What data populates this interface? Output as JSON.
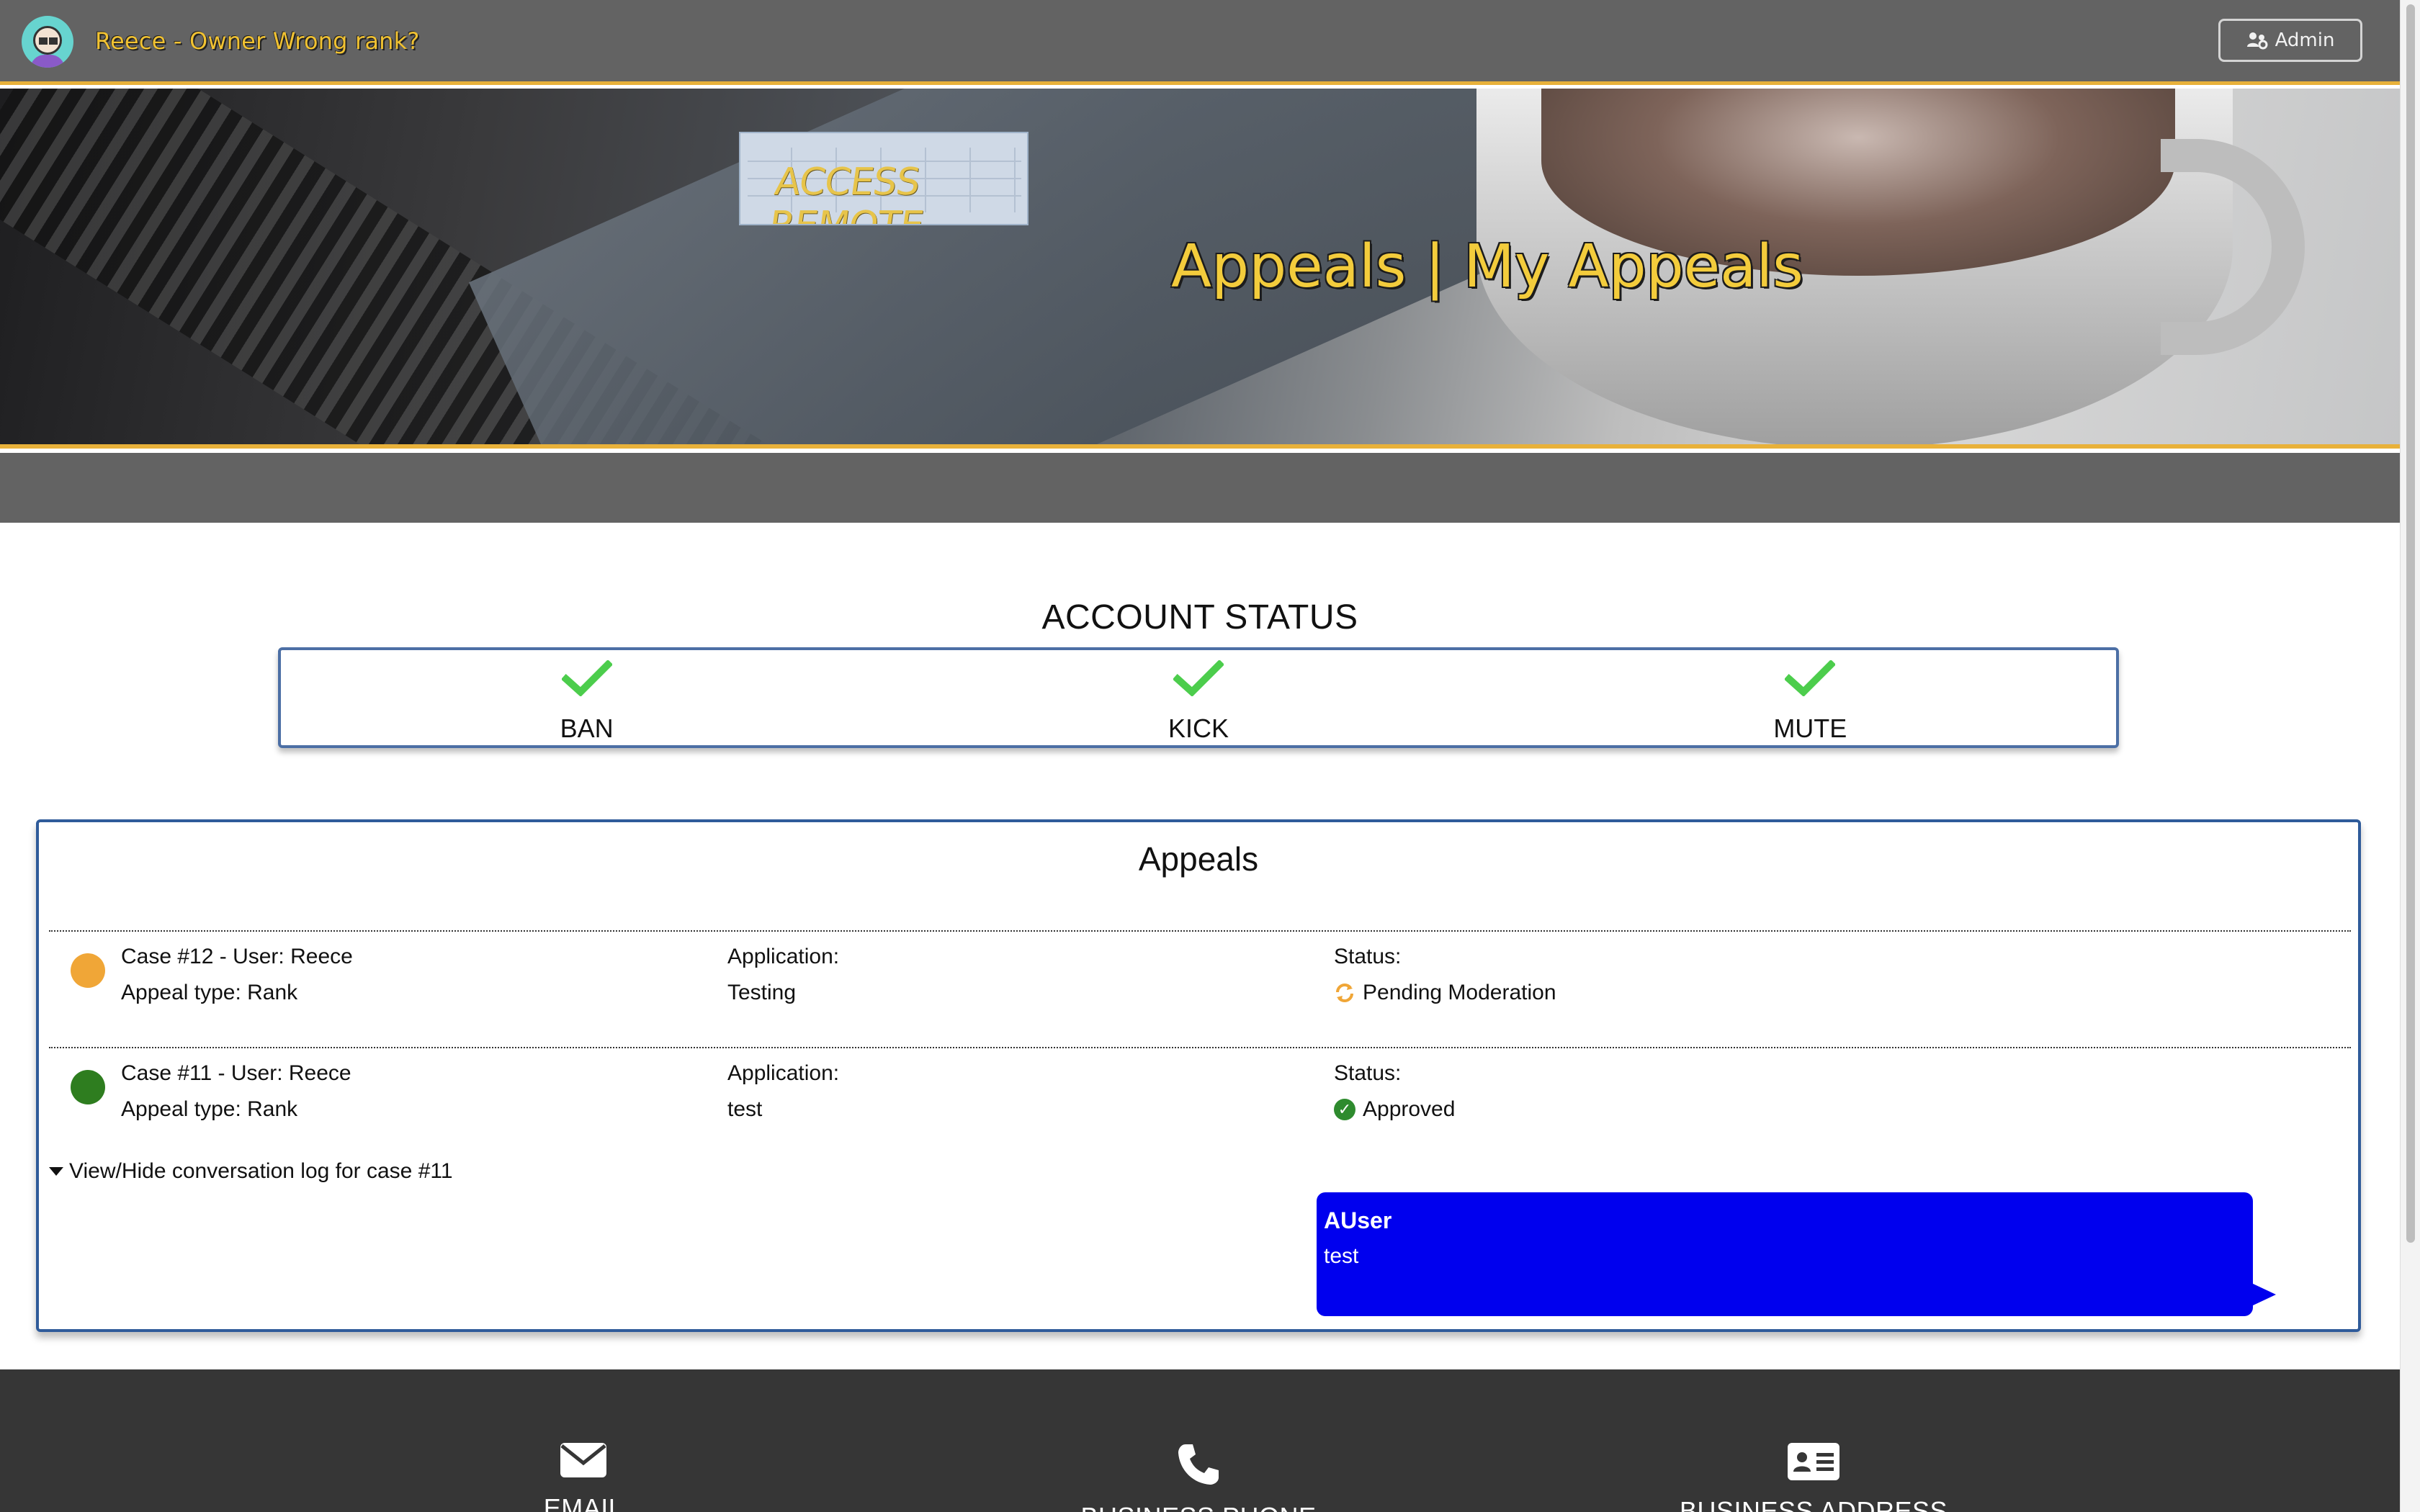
{
  "header": {
    "user_title": "Reece - Owner Wrong rank?",
    "admin_label": "Admin"
  },
  "hero": {
    "logo_text": "ACCESS REMOTE",
    "title": "Appeals | My Appeals"
  },
  "account_status": {
    "heading": "ACCOUNT STATUS",
    "items": [
      {
        "label": "BAN",
        "icon": "check-icon",
        "color": "#4ccd4c"
      },
      {
        "label": "KICK",
        "icon": "check-icon",
        "color": "#4ccd4c"
      },
      {
        "label": "MUTE",
        "icon": "check-icon",
        "color": "#4ccd4c"
      }
    ]
  },
  "appeals": {
    "title": "Appeals",
    "cases": [
      {
        "case_label": "Case #12 - User: Reece",
        "appeal_type": "Appeal type: Rank",
        "application_label": "Application:",
        "application_value": "Testing",
        "status_label": "Status:",
        "status_value": "Pending Moderation",
        "status_icon": "sync-icon",
        "dot_color": "#f0a637"
      },
      {
        "case_label": "Case #11 - User: Reece",
        "appeal_type": "Appeal type: Rank",
        "application_label": "Application:",
        "application_value": "test",
        "status_label": "Status:",
        "status_value": "Approved",
        "status_icon": "check-circle-icon",
        "dot_color": "#2e7d1f"
      }
    ],
    "log_toggle": "View/Hide conversation log for case #11",
    "message": {
      "user": "AUser",
      "text": "test",
      "color": "#0000ee"
    }
  },
  "footer": {
    "items": [
      {
        "label": "EMAIL",
        "icon": "envelope-icon"
      },
      {
        "label": "BUSINESS PHONE",
        "icon": "phone-icon"
      },
      {
        "label": "BUSINESS ADDRESS",
        "icon": "address-card-icon"
      }
    ]
  },
  "colors": {
    "accent": "#e8b13a",
    "topbar": "#636363",
    "footer": "#363636"
  }
}
